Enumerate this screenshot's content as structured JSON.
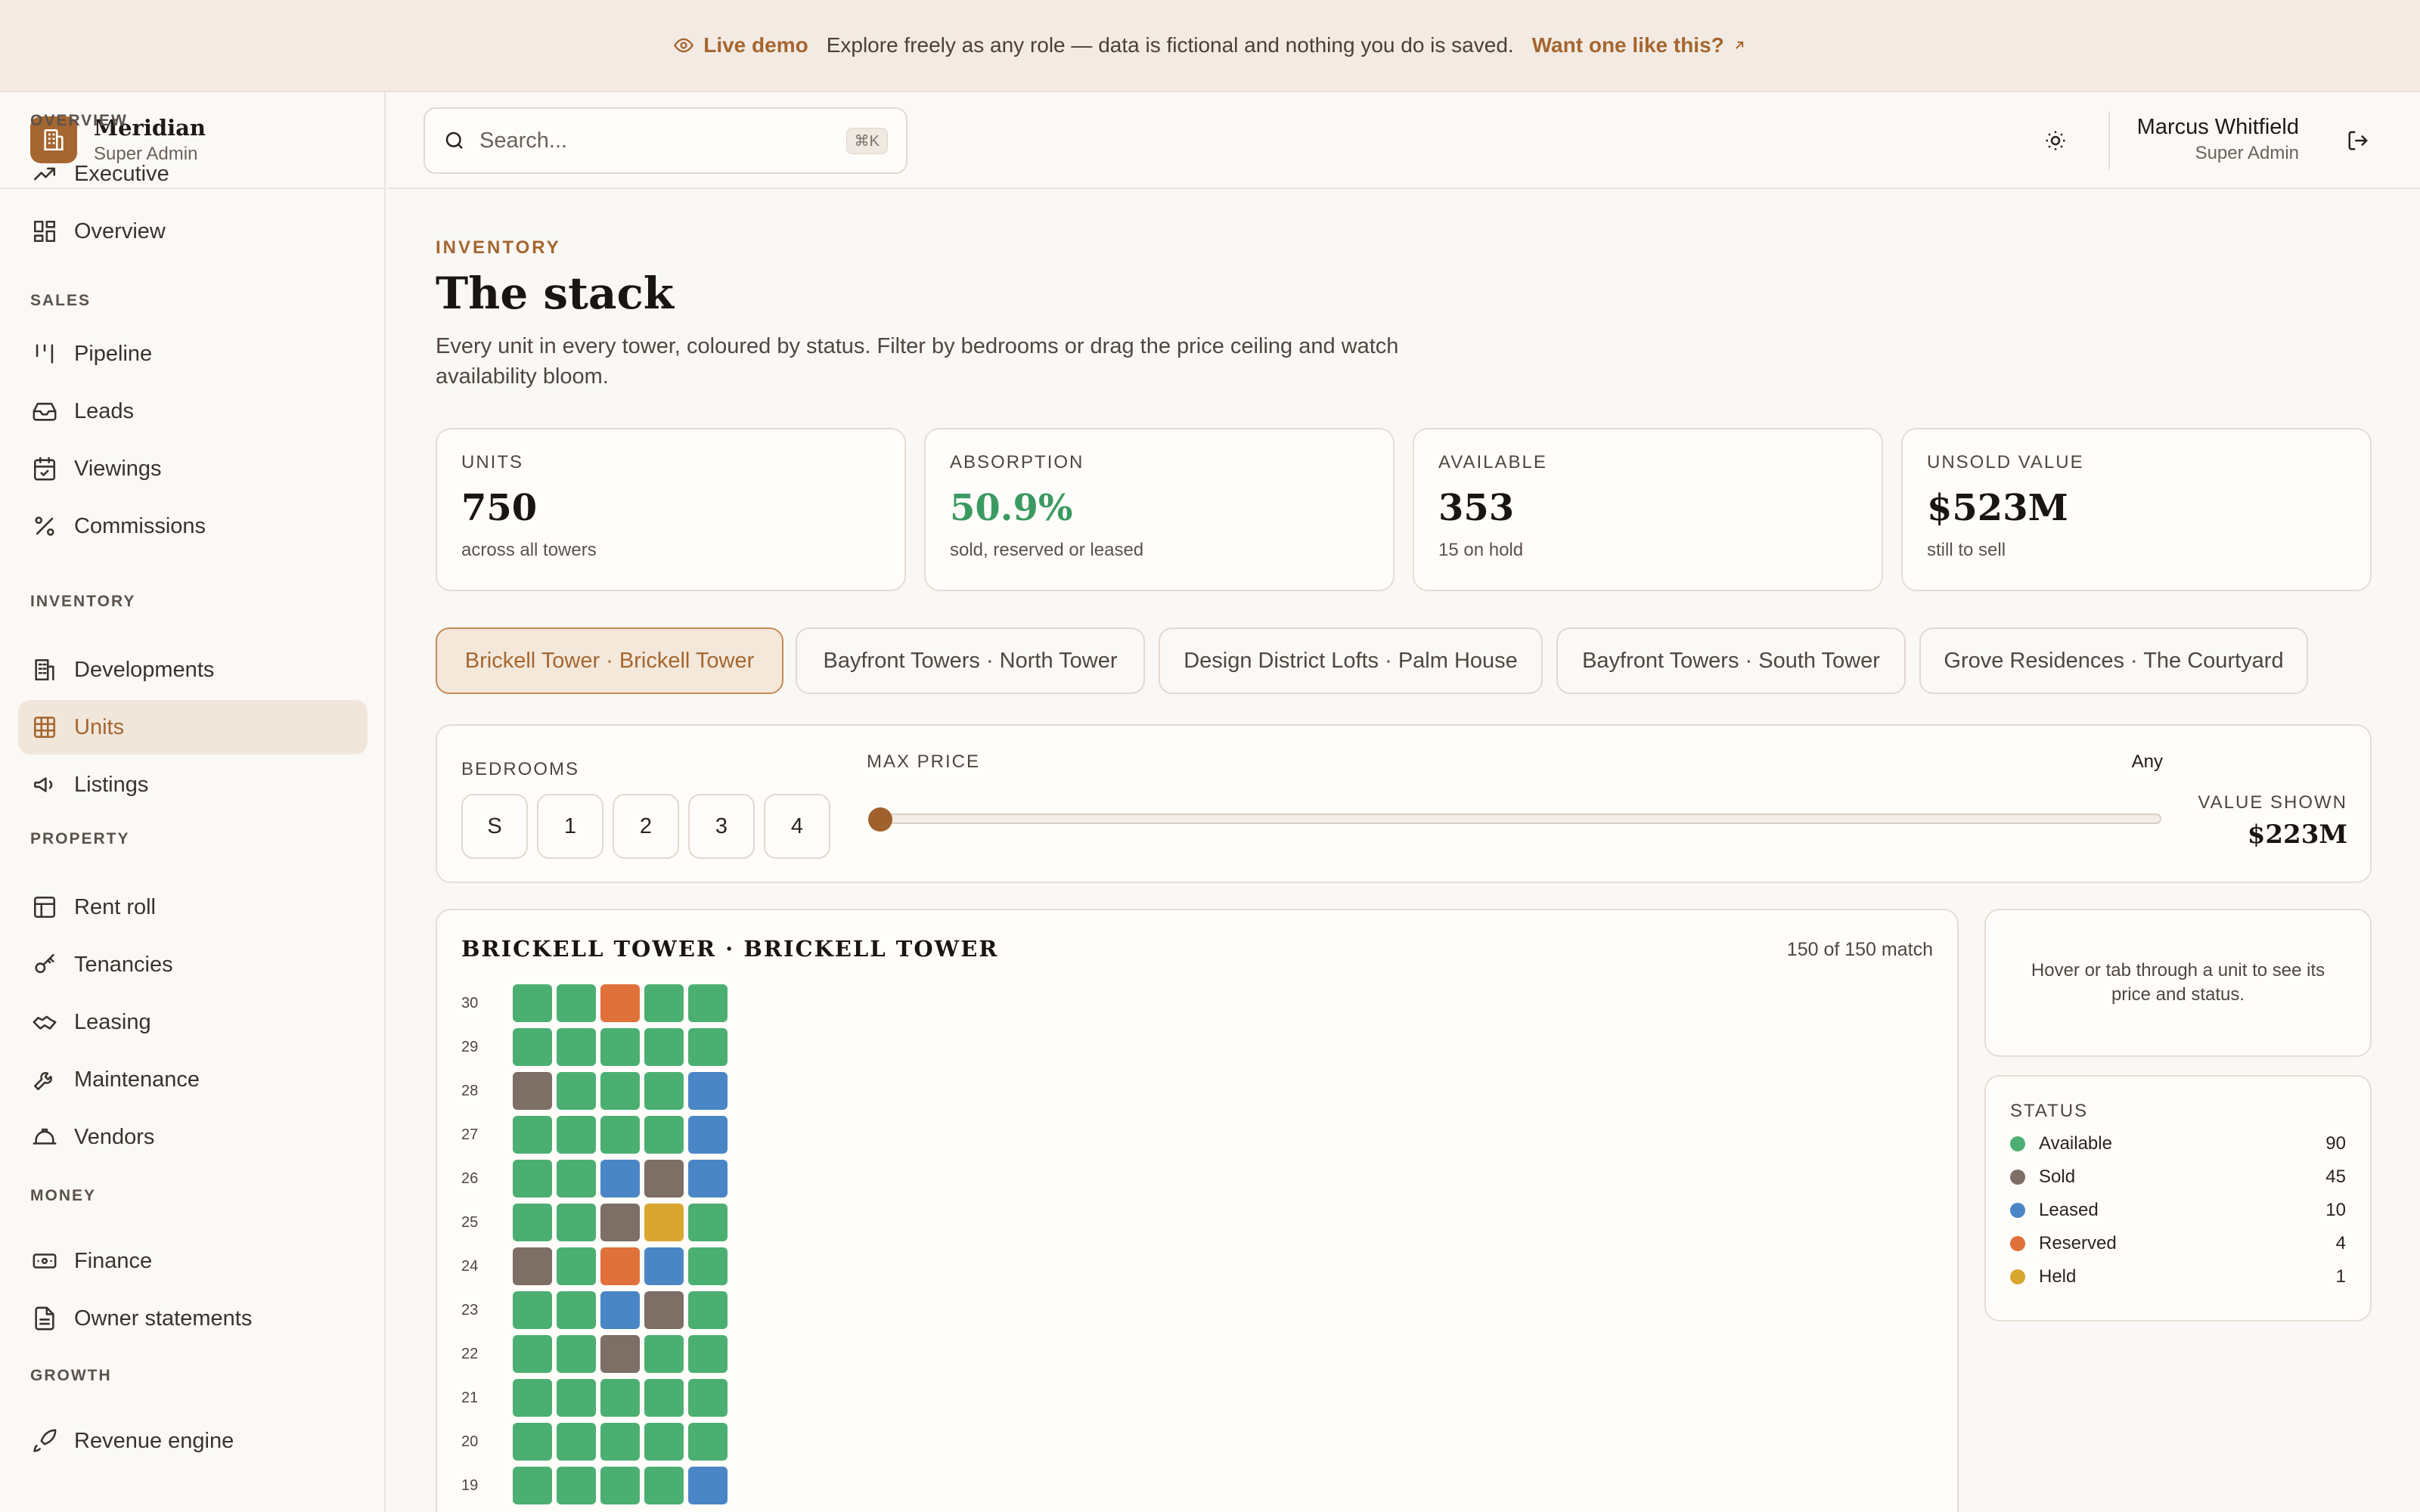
{
  "banner": {
    "live": "Live demo",
    "message": "Explore freely as any role — data is fictional and nothing you do is saved.",
    "cta": "Want one like this?"
  },
  "brand": {
    "name": "Meridian",
    "role": "Super Admin"
  },
  "sidebar": {
    "sections": [
      "OVERVIEW",
      "SALES",
      "INVENTORY",
      "PROPERTY",
      "MONEY",
      "GROWTH"
    ],
    "items": [
      {
        "label": "Executive",
        "icon": "trending-up-icon"
      },
      {
        "label": "Overview",
        "icon": "dashboard-icon"
      },
      {
        "label": "Pipeline",
        "icon": "pipeline-icon"
      },
      {
        "label": "Leads",
        "icon": "inbox-icon"
      },
      {
        "label": "Viewings",
        "icon": "calendar-icon"
      },
      {
        "label": "Commissions",
        "icon": "percent-icon"
      },
      {
        "label": "Developments",
        "icon": "building-icon"
      },
      {
        "label": "Units",
        "icon": "grid-icon",
        "active": true
      },
      {
        "label": "Listings",
        "icon": "megaphone-icon"
      },
      {
        "label": "Rent roll",
        "icon": "table-icon"
      },
      {
        "label": "Tenancies",
        "icon": "key-icon"
      },
      {
        "label": "Leasing",
        "icon": "handshake-icon"
      },
      {
        "label": "Maintenance",
        "icon": "wrench-icon"
      },
      {
        "label": "Vendors",
        "icon": "hard-hat-icon"
      },
      {
        "label": "Finance",
        "icon": "banknote-icon"
      },
      {
        "label": "Owner statements",
        "icon": "document-icon"
      },
      {
        "label": "Revenue engine",
        "icon": "rocket-icon"
      }
    ]
  },
  "topbar": {
    "search_placeholder": "Search...",
    "shortcut": "⌘K",
    "user_name": "Marcus Whitfield",
    "user_role": "Super Admin"
  },
  "page": {
    "eyebrow": "INVENTORY",
    "title": "The stack",
    "description": "Every unit in every tower, coloured by status. Filter by bedrooms or drag the price ceiling and watch availability bloom."
  },
  "kpis": [
    {
      "label": "UNITS",
      "value": "750",
      "sub": "across all towers"
    },
    {
      "label": "ABSORPTION",
      "value": "50.9%",
      "sub": "sold, reserved or leased"
    },
    {
      "label": "AVAILABLE",
      "value": "353",
      "sub": "15 on hold"
    },
    {
      "label": "UNSOLD VALUE",
      "value": "$523M",
      "sub": "still to sell"
    }
  ],
  "towers": [
    "Brickell Tower · Brickell Tower",
    "Bayfront Towers · North Tower",
    "Design District Lofts · Palm House",
    "Bayfront Towers · South Tower",
    "Grove Residences · The Courtyard"
  ],
  "filters": {
    "bedrooms_label": "BEDROOMS",
    "bedrooms": [
      "S",
      "1",
      "2",
      "3",
      "4"
    ],
    "max_price_label": "MAX PRICE",
    "max_price_value": "Any",
    "slider_position": 0,
    "value_shown_label": "VALUE SHOWN",
    "value_shown": "$223M"
  },
  "stack": {
    "title": "BRICKELL TOWER · BRICKELL TOWER",
    "match": "150 of 150 match",
    "floors": [
      {
        "floor": "30",
        "units": [
          "A",
          "A",
          "R",
          "A",
          "A"
        ]
      },
      {
        "floor": "29",
        "units": [
          "A",
          "A",
          "A",
          "A",
          "A"
        ]
      },
      {
        "floor": "28",
        "units": [
          "S",
          "A",
          "A",
          "A",
          "L"
        ]
      },
      {
        "floor": "27",
        "units": [
          "A",
          "A",
          "A",
          "A",
          "L"
        ]
      },
      {
        "floor": "26",
        "units": [
          "A",
          "A",
          "L",
          "S",
          "L"
        ]
      },
      {
        "floor": "25",
        "units": [
          "A",
          "A",
          "S",
          "H",
          "A"
        ]
      },
      {
        "floor": "24",
        "units": [
          "S",
          "A",
          "R",
          "L",
          "A"
        ]
      },
      {
        "floor": "23",
        "units": [
          "A",
          "A",
          "L",
          "S",
          "A"
        ]
      },
      {
        "floor": "22",
        "units": [
          "A",
          "A",
          "S",
          "A",
          "A"
        ]
      },
      {
        "floor": "21",
        "units": [
          "A",
          "A",
          "A",
          "A",
          "A"
        ]
      },
      {
        "floor": "20",
        "units": [
          "A",
          "A",
          "A",
          "A",
          "A"
        ]
      },
      {
        "floor": "19",
        "units": [
          "A",
          "A",
          "A",
          "A",
          "L"
        ]
      }
    ]
  },
  "hover_hint": "Hover or tab through a unit to see its price and status.",
  "status": {
    "title": "STATUS",
    "items": [
      {
        "code": "A",
        "label": "Available",
        "count": "90",
        "color": "#4caf72"
      },
      {
        "code": "S",
        "label": "Sold",
        "count": "45",
        "color": "#7d6e66"
      },
      {
        "code": "L",
        "label": "Leased",
        "count": "10",
        "color": "#4a86c5"
      },
      {
        "code": "R",
        "label": "Reserved",
        "count": "4",
        "color": "#e0713a"
      },
      {
        "code": "H",
        "label": "Held",
        "count": "1",
        "color": "#d9a630"
      }
    ]
  },
  "colors": {
    "accent": "#a5662f"
  }
}
